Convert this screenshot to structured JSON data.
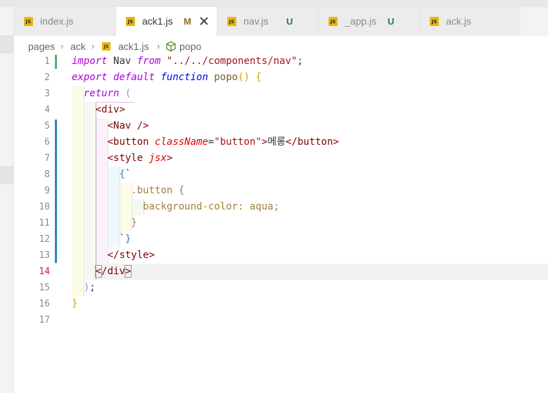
{
  "tabs": [
    {
      "name": "index.js",
      "status": "",
      "active": false
    },
    {
      "name": "ack1.js",
      "status": "M",
      "active": true
    },
    {
      "name": "nav.js",
      "status": "U",
      "active": false
    },
    {
      "name": "_app.js",
      "status": "U",
      "active": false
    },
    {
      "name": "ack.js",
      "status": "",
      "active": false
    }
  ],
  "icons": {
    "file_type": "JS",
    "symbol": "cube-icon",
    "close": "close-icon"
  },
  "breadcrumb": [
    "pages",
    "ack",
    "ack1.js",
    "popo"
  ],
  "editor": {
    "current_line": 14,
    "line_numbers": [
      "1",
      "2",
      "3",
      "4",
      "5",
      "6",
      "7",
      "8",
      "9",
      "10",
      "11",
      "12",
      "13",
      "14",
      "15",
      "16",
      "17"
    ],
    "tokens": {
      "import": "import",
      "nav_ident": "Nav",
      "from": "from",
      "nav_path": "\"../../components/nav\"",
      "export": "export",
      "default": "default",
      "function": "function",
      "fn_name": "popo",
      "return": "return",
      "div": "div",
      "button": "button",
      "classname": "className",
      "button_class": "\"button\"",
      "button_text": "메롱",
      "style": "style",
      "jsx": "jsx",
      "css_selector": ".button",
      "css_decl": "background-color: aqua;"
    }
  },
  "colors": {
    "modified": "#8f6d16",
    "untracked": "#2a7a3f",
    "git_added": "#48b46b",
    "git_modified": "#2b83c7",
    "current_line_number": "#c4243f"
  }
}
